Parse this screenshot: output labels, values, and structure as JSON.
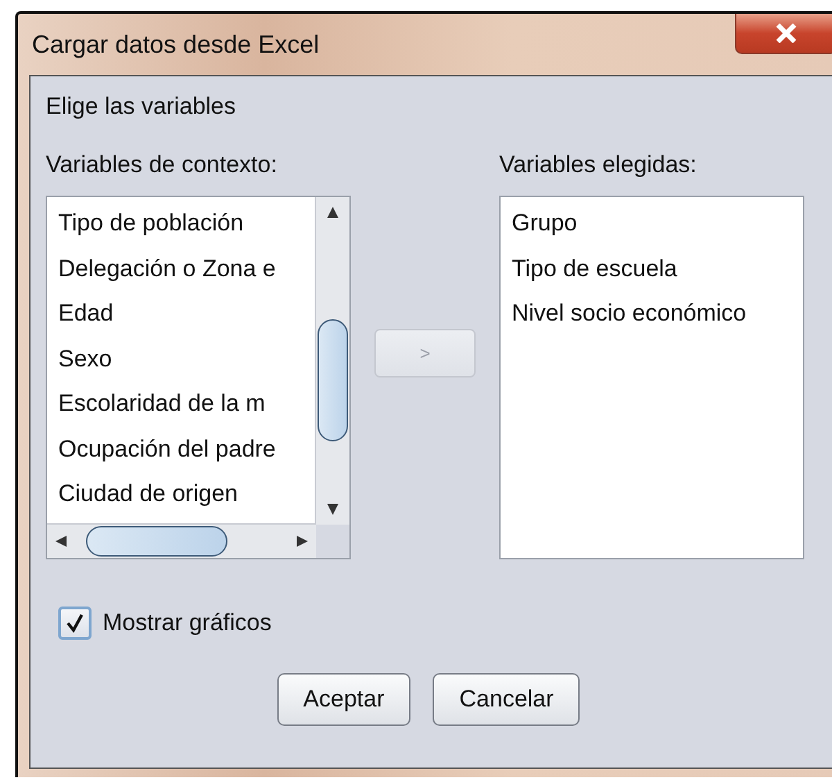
{
  "window": {
    "title": "Cargar datos desde Excel"
  },
  "heading": "Elige las variables",
  "context_list": {
    "label": "Variables de contexto:",
    "items": [
      "Tipo de población",
      "Delegación o Zona e",
      "Edad",
      "Sexo",
      "Escolaridad de la m",
      "Ocupación del padre",
      "Ciudad de origen"
    ]
  },
  "move_button": {
    "label": ">",
    "disabled": true
  },
  "chosen_list": {
    "label": "Variables elegidas:",
    "items": [
      "Grupo",
      "Tipo de escuela",
      "Nivel socio económico"
    ]
  },
  "show_charts": {
    "label": "Mostrar gráficos",
    "checked": true
  },
  "buttons": [
    "Aceptar",
    "Cancelar"
  ]
}
